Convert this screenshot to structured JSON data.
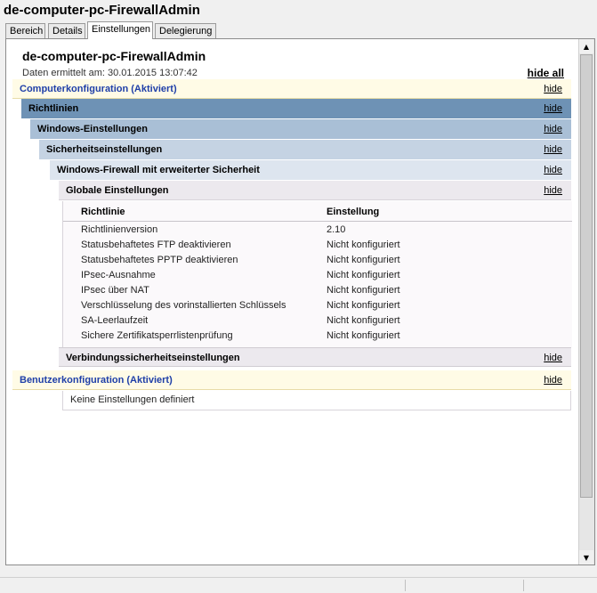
{
  "window": {
    "title": "de-computer-pc-FirewallAdmin"
  },
  "tabs": [
    "Bereich",
    "Details",
    "Einstellungen",
    "Delegierung"
  ],
  "report": {
    "title": "de-computer-pc-FirewallAdmin",
    "date": "Daten ermittelt am: 30.01.2015 13:07:42",
    "hide_all": "hide all",
    "hide": "hide",
    "computer_config": "Computerkonfiguration (Aktiviert)",
    "richtlinien": "Richtlinien",
    "windows_settings": "Windows-Einstellungen",
    "security_settings": "Sicherheitseinstellungen",
    "firewall": "Windows-Firewall mit erweiterter Sicherheit",
    "global_settings": "Globale Einstellungen",
    "table": {
      "headers": [
        "Richtlinie",
        "Einstellung"
      ],
      "rows": [
        [
          "Richtlinienversion",
          "2.10"
        ],
        [
          "Statusbehaftetes FTP deaktivieren",
          "Nicht konfiguriert"
        ],
        [
          "Statusbehaftetes PPTP deaktivieren",
          "Nicht konfiguriert"
        ],
        [
          "IPsec-Ausnahme",
          "Nicht konfiguriert"
        ],
        [
          "IPsec über NAT",
          "Nicht konfiguriert"
        ],
        [
          "Verschlüsselung des vorinstallierten Schlüssels",
          "Nicht konfiguriert"
        ],
        [
          "SA-Leerlaufzeit",
          "Nicht konfiguriert"
        ],
        [
          "Sichere Zertifikatsperrlistenprüfung",
          "Nicht konfiguriert"
        ]
      ]
    },
    "connection_security": "Verbindungssicherheitseinstellungen",
    "user_config": "Benutzerkonfiguration (Aktiviert)",
    "no_settings": "Keine Einstellungen definiert"
  }
}
